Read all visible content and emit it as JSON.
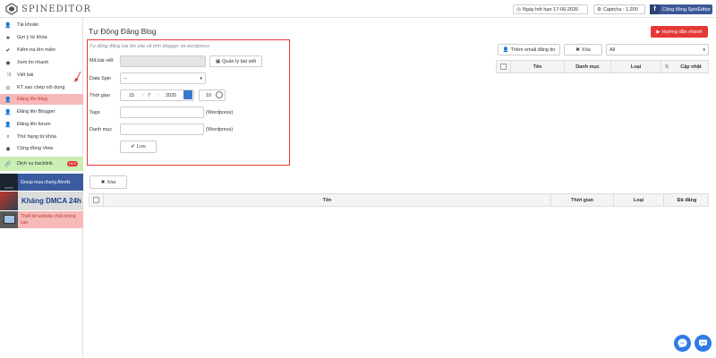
{
  "header": {
    "logo_text": "SPINEDITOR",
    "expire_label": "Ngày hết hạn 17-06-2026",
    "captcha_label": "Captcha : 1,200",
    "facebook_label": "Cộng đồng SpinEditor"
  },
  "sidebar": {
    "items": [
      {
        "label": "Tài khoản",
        "icon": "user-icon"
      },
      {
        "label": "Gợi ý từ khóa",
        "icon": "star-icon"
      },
      {
        "label": "Kiểm tra tên miền",
        "icon": "check-icon"
      },
      {
        "label": "Xem tin nhanh",
        "icon": "eye-icon"
      },
      {
        "label": "Viết bài",
        "icon": "shuffle-icon"
      },
      {
        "label": "KT sao chép nội dung",
        "icon": "copy-check-icon"
      },
      {
        "label": "Đăng lên blog",
        "icon": "user-icon"
      },
      {
        "label": "Đăng lên Blogger",
        "icon": "user-icon"
      },
      {
        "label": "Đăng lên forum",
        "icon": "user-icon"
      },
      {
        "label": "Thứ hạng từ khóa",
        "icon": "search-icon"
      },
      {
        "label": "Cộng đồng View",
        "icon": "eye-icon"
      },
      {
        "label": "Dịch vụ backlink",
        "icon": "link-icon"
      }
    ],
    "hot_badge": "HOT",
    "banner1_thumb": "ahrefs",
    "banner1_text": "Group mua chung Ahrefs",
    "banner2_text": "Kháng DMCA 24h",
    "banner3_text": "Thiết kế website chất lượng cao"
  },
  "main": {
    "title": "Tự Động Đăng Blog",
    "guide_button": "Hướng dẫn nhanh",
    "hint": "Tự động đăng bài lên site vệ tinh blogger và wordpress",
    "form": {
      "ma_bai_viet_label": "Mã bài viết",
      "manage_button": "Quản lý bài viết",
      "data_spin_label": "Data Spin",
      "data_spin_value": "--",
      "thoi_gian_label": "Thời gian",
      "day": "15",
      "month": "7",
      "year": "2025",
      "sep": "/",
      "hour": "10",
      "tags_label": "Tags",
      "tags_suffix": "(Wordpress)",
      "danh_muc_label": "Danh mục",
      "danh_muc_suffix": "(Wordpress)",
      "save_button": "Lưu"
    },
    "right_panel": {
      "add_email_button": "Thêm email đăng tin",
      "delete_button": "Xóa",
      "filter_value": "All",
      "columns": [
        "Tên",
        "Danh mục",
        "Loại",
        "Cập nhật"
      ]
    },
    "bottom_panel": {
      "delete_button": "Xóa",
      "columns": [
        "Tên",
        "Thời gian",
        "Loại",
        "Đã đăng"
      ]
    }
  },
  "colors": {
    "accent_red": "#e53935",
    "active_bg": "#f7b8b8",
    "facebook": "#3b5998",
    "messenger": "#2e7be6"
  }
}
